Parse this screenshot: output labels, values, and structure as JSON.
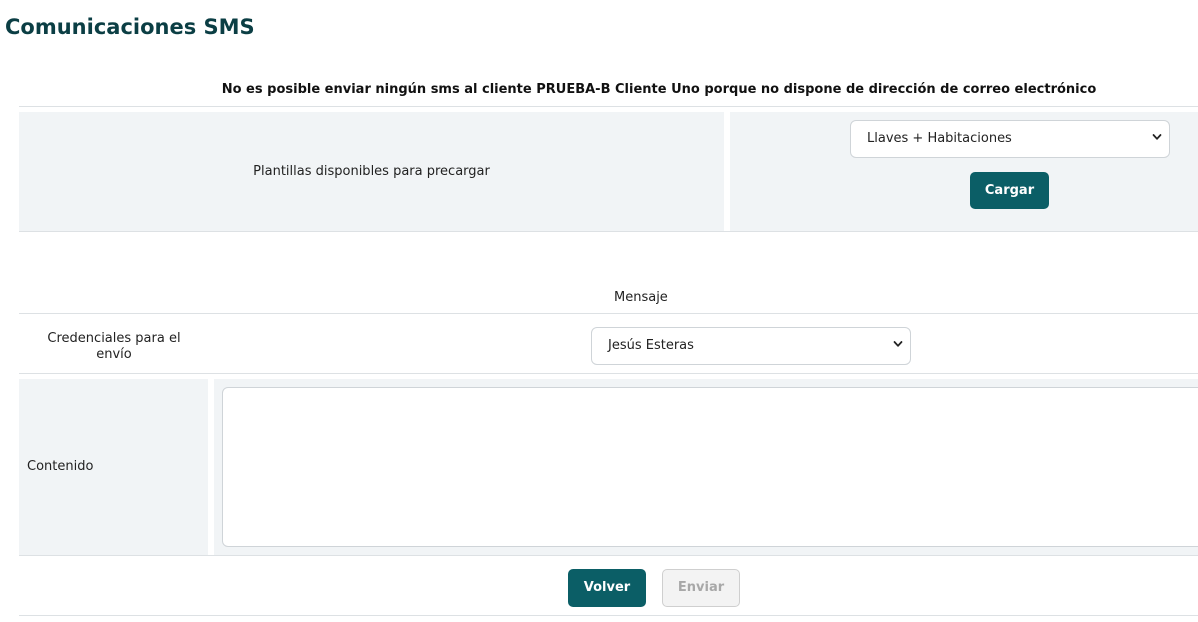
{
  "page": {
    "title": "Comunicaciones SMS"
  },
  "warning": "No es posible enviar ningún sms al cliente PRUEBA-B Cliente Uno porque no dispone de dirección de correo electrónico",
  "templates": {
    "label": "Plantillas disponibles para precargar",
    "selected": "Llaves + Habitaciones",
    "load_button": "Cargar"
  },
  "message": {
    "section_label": "Mensaje",
    "credentials_label": "Credenciales para el envío",
    "credentials_selected": "Jesús Esteras",
    "content_label": "Contenido",
    "content_value": ""
  },
  "actions": {
    "back": "Volver",
    "send": "Enviar"
  },
  "colors": {
    "accent": "#0b5e66",
    "title": "#0b3e44",
    "panel": "#f1f4f6"
  }
}
